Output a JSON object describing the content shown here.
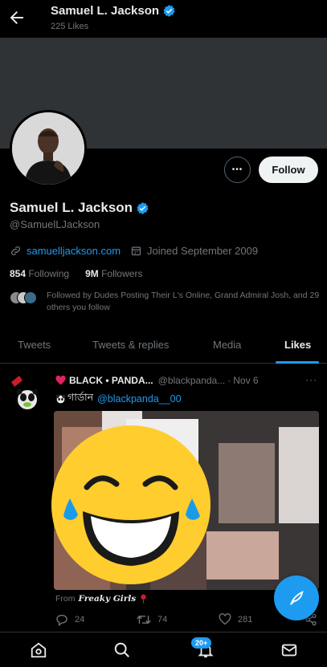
{
  "header": {
    "title": "Samuel L. Jackson",
    "subtitle": "225 Likes"
  },
  "profile": {
    "display_name": "Samuel L. Jackson",
    "handle": "@SamuelLJackson",
    "website": "samuelljackson.com",
    "joined": "Joined September 2009",
    "following_count": "854",
    "following_label": "Following",
    "followers_count": "9M",
    "followers_label": "Followers",
    "followed_by": "Followed by Dudes Posting Their L's Online, Grand Admiral Josh, and 29 others you follow",
    "follow_label": "Follow",
    "more_label": "•••"
  },
  "tabs": [
    {
      "label": "Tweets"
    },
    {
      "label": "Tweets & replies"
    },
    {
      "label": "Media"
    },
    {
      "label": "Likes"
    }
  ],
  "post": {
    "author": "BLACK • PANDA...",
    "handle": "@blackpanda...",
    "separator": "·",
    "date": "Nov 6",
    "more": "···",
    "sub_name": "গার্ডান",
    "mention": "@blackpanda__00",
    "source_prefix": "From",
    "source_name": "Freaky Girls",
    "replies": "24",
    "retweets": "74",
    "likes": "281"
  },
  "nav": {
    "badge": "20+"
  },
  "colors": {
    "accent": "#1d9bf0",
    "background": "#000000",
    "muted": "#71767b",
    "text": "#e7e9ea"
  }
}
